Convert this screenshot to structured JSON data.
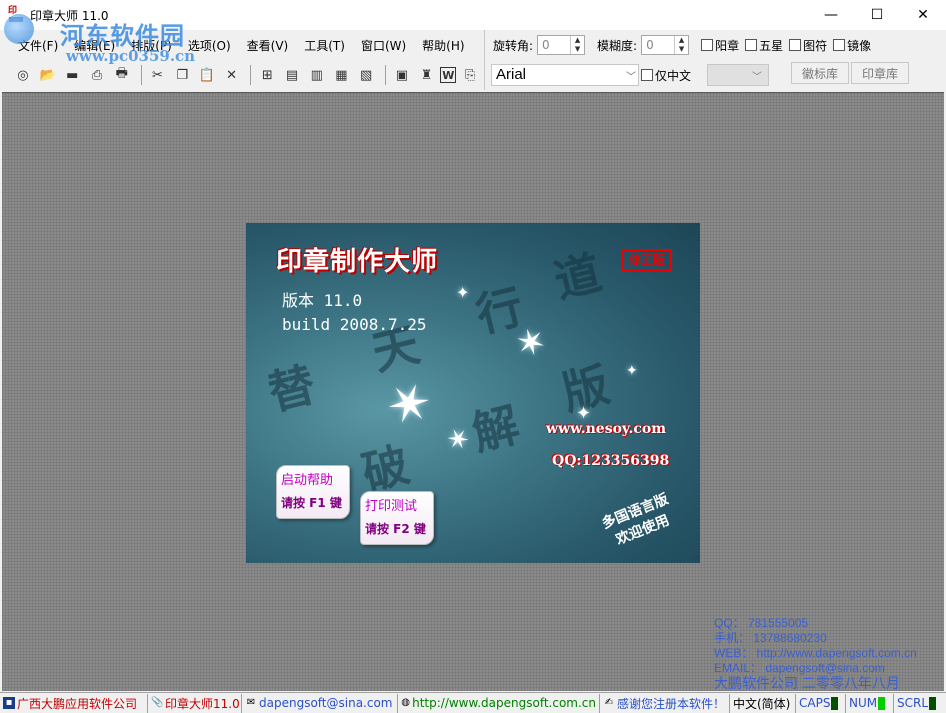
{
  "window": {
    "title": "印章大师 11.0",
    "icon": "stamp-app-icon",
    "icon_glyph": "印",
    "controls": {
      "minimize": "—",
      "maximize": "☐",
      "close": "✕"
    }
  },
  "watermark": {
    "title": "河东软件园",
    "url": "www.pc0359.cn"
  },
  "menu": {
    "items": [
      {
        "label": "文件(F)"
      },
      {
        "label": "编辑(E)"
      },
      {
        "label": "排版(P)"
      },
      {
        "label": "选项(O)"
      },
      {
        "label": "查看(V)"
      },
      {
        "label": "工具(T)"
      },
      {
        "label": "窗口(W)"
      },
      {
        "label": "帮助(H)"
      }
    ]
  },
  "toolbar": {
    "buttons": [
      {
        "icon": "new-icon",
        "glyph": "◎"
      },
      {
        "icon": "open-icon",
        "glyph": "📂"
      },
      {
        "icon": "save-icon",
        "glyph": "▬"
      },
      {
        "icon": "print-preview-icon",
        "glyph": "⎙"
      },
      {
        "icon": "print-icon",
        "glyph": "🖶"
      },
      {
        "icon": "cut-icon",
        "glyph": "✂"
      },
      {
        "icon": "copy-icon",
        "glyph": "❐"
      },
      {
        "icon": "paste-icon",
        "glyph": "📋"
      },
      {
        "icon": "delete-icon",
        "glyph": "✕"
      },
      {
        "icon": "align-center-icon",
        "glyph": "⊞"
      },
      {
        "icon": "align-left-icon",
        "glyph": "▤"
      },
      {
        "icon": "align-right-icon",
        "glyph": "▥"
      },
      {
        "icon": "align-top-icon",
        "glyph": "▦"
      },
      {
        "icon": "align-bottom-icon",
        "glyph": "▧"
      },
      {
        "icon": "image-icon",
        "glyph": "▣"
      },
      {
        "icon": "seal-icon",
        "glyph": "♜"
      },
      {
        "icon": "word-icon",
        "glyph": "W"
      },
      {
        "icon": "export-icon",
        "glyph": "⎘"
      }
    ]
  },
  "props": {
    "rotation_label": "旋转角:",
    "rotation_value": "0",
    "blur_label": "模糊度:",
    "blur_value": "0",
    "checks": [
      "阳章",
      "五星",
      "图符",
      "镜像"
    ],
    "font": "Arial",
    "chinese_only": "仅中文",
    "tabs": [
      "徽标库",
      "印章库"
    ]
  },
  "splash": {
    "title": "印章制作大师",
    "stamp": "修正版",
    "version": "版本 11.0",
    "build": "build 2008.7.25",
    "calligraphy": [
      "替",
      "天",
      "行",
      "道",
      "破",
      "解",
      "版"
    ],
    "url": "www.nesoy.com",
    "qq": "QQ:123356398",
    "help_card": {
      "line1": "启动帮助",
      "line2": "请按 F1 键"
    },
    "print_card": {
      "line1": "打印测试",
      "line2": "请按 F2 键"
    },
    "multi_lang": [
      "多国语言版",
      "欢迎使用"
    ]
  },
  "info": {
    "qq": "QQ：  781555005",
    "phone": "手机：  13788680230",
    "web": "WEB：  http://www.dapengsoft.com.cn",
    "email": "EMAIL：  dapengsoft@sina.com",
    "company": "大鹏软件公司  二零零八年八月"
  },
  "statusbar": {
    "company": "广西大鹏应用软件公司",
    "product": "印章大师11.0",
    "email": "dapengsoft@sina.com",
    "website": "http://www.dapengsoft.com.cn",
    "thanks": "感谢您注册本软件！",
    "language": "中文(简体)",
    "caps": "CAPS",
    "num": "NUM",
    "scrl": "SCRL",
    "colors": {
      "red": "#c00000",
      "blue": "#2b50c8",
      "indicator_on": "#00cc00",
      "indicator_off": "#005000"
    }
  }
}
